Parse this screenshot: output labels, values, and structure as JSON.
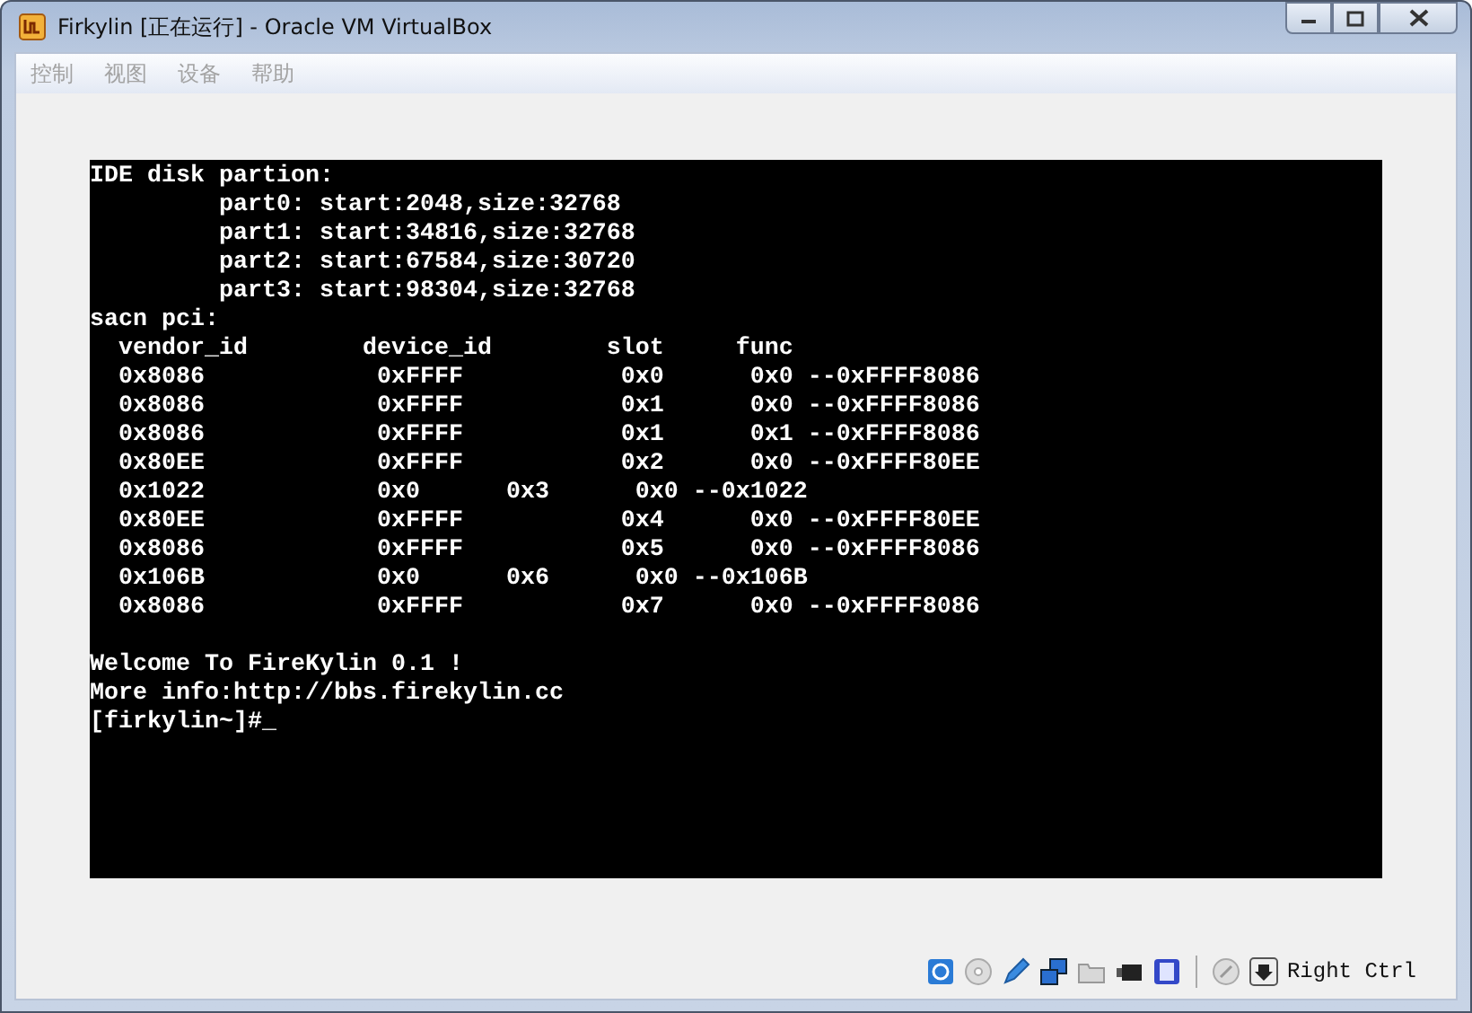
{
  "window": {
    "title": "Firkylin [正在运行] - Oracle VM VirtualBox"
  },
  "menu": [
    {
      "label": "控制",
      "disabled": true
    },
    {
      "label": "视图",
      "disabled": true
    },
    {
      "label": "设备",
      "disabled": true
    },
    {
      "label": "帮助",
      "disabled": true
    }
  ],
  "terminal": {
    "blocks": [
      [
        "IDE disk partion:",
        "         part0: start:2048,size:32768",
        "         part1: start:34816,size:32768",
        "         part2: start:67584,size:30720",
        "         part3: start:98304,size:32768",
        "sacn pci:",
        "  vendor_id        device_id        slot     func",
        "  0x8086            0xFFFF           0x0      0x0 --0xFFFF8086",
        "  0x8086            0xFFFF           0x1      0x0 --0xFFFF8086",
        "  0x8086            0xFFFF           0x1      0x1 --0xFFFF8086",
        "  0x80EE            0xFFFF           0x2      0x0 --0xFFFF80EE",
        "  0x1022            0x0      0x3      0x0 --0x1022",
        "  0x80EE            0xFFFF           0x4      0x0 --0xFFFF80EE",
        "  0x8086            0xFFFF           0x5      0x0 --0xFFFF8086",
        "  0x106B            0x0      0x6      0x0 --0x106B",
        "  0x8086            0xFFFF           0x7      0x0 --0xFFFF8086"
      ],
      [
        "Welcome To FireKylin 0.1 !",
        "More info:http://bbs.firekylin.cc",
        "[firkylin~]#_"
      ]
    ]
  },
  "status_bar": {
    "host_key": "Right Ctrl"
  }
}
